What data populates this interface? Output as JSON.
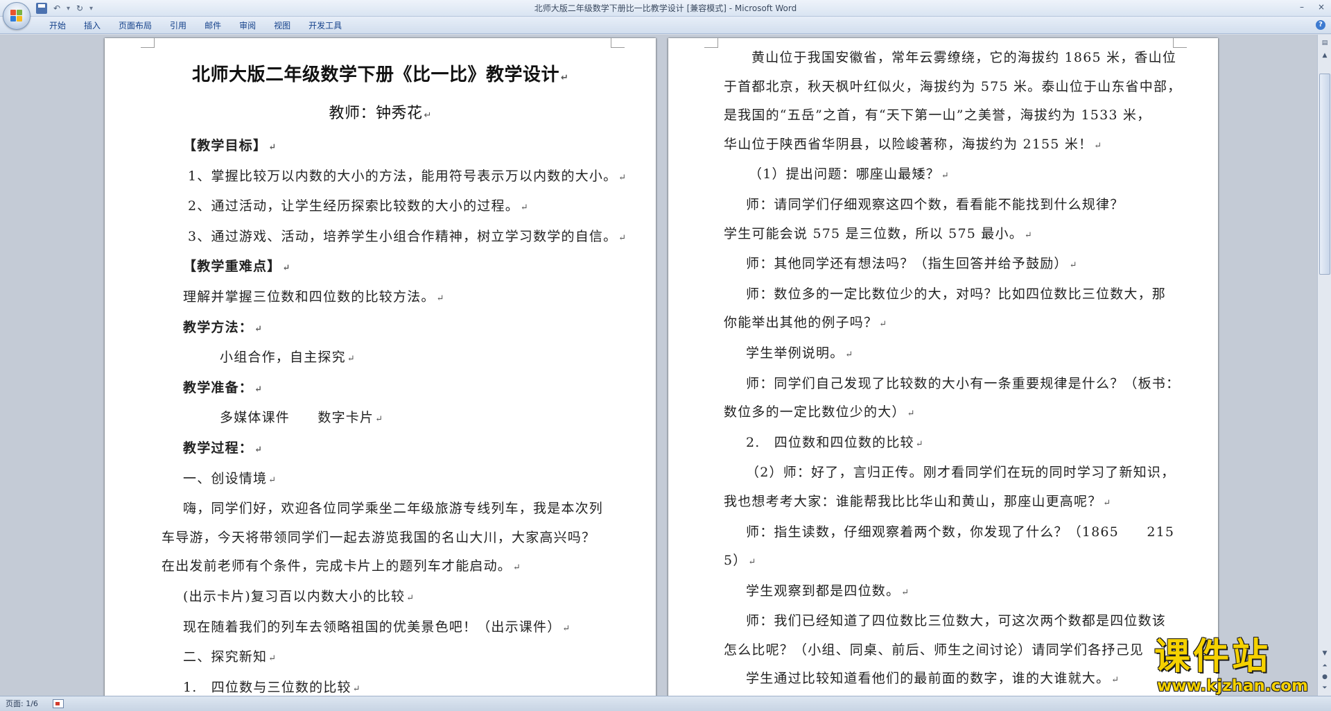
{
  "window": {
    "title": "北师大版二年级数学下册比一比教学设计 [兼容模式] - Microsoft Word",
    "minimize_icon": "minimize-icon",
    "close_icon": "close-icon"
  },
  "quick_access": {
    "save_icon": "save-icon",
    "undo_icon": "undo-icon",
    "redo_icon": "redo-icon",
    "customize_icon": "dropdown-arrow-icon"
  },
  "ribbon": {
    "tabs": [
      "开始",
      "插入",
      "页面布局",
      "引用",
      "邮件",
      "审阅",
      "视图",
      "开发工具"
    ]
  },
  "left_page": {
    "title": "北师大版二年级数学下册《比一比》教学设计",
    "author": "教师：钟秀花",
    "lines": [
      "【教学目标】",
      "1、掌握比较万以内数的大小的方法，能用符号表示万以内数的大小。",
      "2、通过活动，让学生经历探索比较数的大小的过程。",
      "3、通过游戏、活动，培养学生小组合作精神，树立学习数学的自信。",
      "【教学重难点】",
      "理解并掌握三位数和四位数的比较方法。",
      "教学方法：",
      "小组合作，自主探究",
      "教学准备：",
      "多媒体课件　　数字卡片",
      "教学过程：",
      "一、创设情境",
      "嗨，同学们好，欢迎各位同学乘坐二年级旅游专线列车，我是本次列",
      "车导游，今天将带领同学们一起去游览我国的名山大川，大家高兴吗？",
      "在出发前老师有个条件，完成卡片上的题列车才能启动。",
      "(出示卡片)复习百以内数大小的比较",
      "现在随着我们的列车去领略祖国的优美景色吧！（出示课件）",
      "二、探究新知",
      "1.　四位数与三位数的比较"
    ]
  },
  "right_page": {
    "lines": [
      "黄山位于我国安徽省，常年云雾缭绕，它的海拔约 1865 米，香山位",
      "于首都北京，秋天枫叶红似火，海拔约为 575 米。泰山位于山东省中部，",
      "是我国的“五岳”之首，有“天下第一山”之美誉，海拔约为 1533 米，",
      "华山位于陕西省华阴县，以险峻著称，海拔约为 2155 米！",
      "（1）提出问题：哪座山最矮？",
      "师：请同学们仔细观察这四个数，看看能不能找到什么规律？",
      "学生可能会说 575 是三位数，所以 575 最小。",
      "师：其他同学还有想法吗？（指生回答并给予鼓励）",
      "师：数位多的一定比数位少的大，对吗？比如四位数比三位数大，那",
      "你能举出其他的例子吗？",
      "学生举例说明。",
      "师：同学们自己发现了比较数的大小有一条重要规律是什么？（板书：",
      "数位多的一定比数位少的大）",
      "2.　四位数和四位数的比较",
      "（2）师：好了，言归正传。刚才看同学们在玩的同时学习了新知识，",
      "我也想考考大家：谁能帮我比比华山和黄山，那座山更高呢？",
      "师：指生读数，仔细观察着两个数，你发现了什么？（1865　　215",
      "5）",
      "学生观察到都是四位数。",
      "师：我们已经知道了四位数比三位数大，可这次两个数都是四位数该",
      "怎么比呢？（小组、同桌、前后、师生之间讨论）请同学们各抒己见",
      "学生通过比较知道看他们的最前面的数字，谁的大谁就大。"
    ]
  },
  "status_bar": {
    "page_counter": "页面: 1/6"
  },
  "watermark": {
    "text": "课件站",
    "url": "www.kjzhan.com"
  }
}
